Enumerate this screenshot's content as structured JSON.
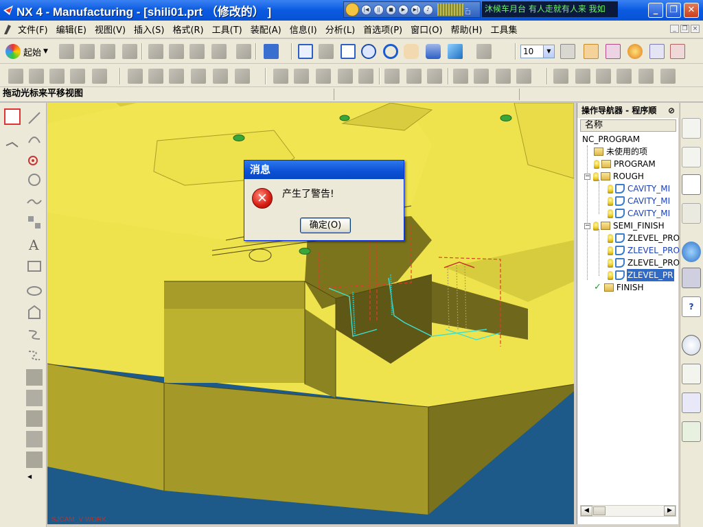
{
  "window": {
    "title": "NX 4 - Manufacturing - [shili01.prt （修改的） ]",
    "ticker": "沐候车月台   有人走就有人来   我如"
  },
  "menu": {
    "items": [
      "文件(F)",
      "编辑(E)",
      "视图(V)",
      "插入(S)",
      "格式(R)",
      "工具(T)",
      "装配(A)",
      "信息(I)",
      "分析(L)",
      "首选项(P)",
      "窗口(O)",
      "帮助(H)",
      "工具集"
    ]
  },
  "toolbar": {
    "start_label": "起始",
    "zoom_value": "10"
  },
  "cue_line": "拖动光标来平移视图",
  "viewport": {
    "wcs_label": "SJCAM_V WORK"
  },
  "navigator": {
    "title": "操作导航器 - 程序顺",
    "column_header": "名称",
    "nodes": [
      {
        "label": "NC_PROGRAM"
      },
      {
        "label": "未使用的项"
      },
      {
        "label": "PROGRAM"
      },
      {
        "label": "ROUGH"
      },
      {
        "label": "CAVITY_MI"
      },
      {
        "label": "CAVITY_MI"
      },
      {
        "label": "CAVITY_MI"
      },
      {
        "label": "SEMI_FINISH"
      },
      {
        "label": "ZLEVEL_PRO"
      },
      {
        "label": "ZLEVEL_PRO"
      },
      {
        "label": "ZLEVEL_PRO"
      },
      {
        "label": "ZLEVEL_PR"
      },
      {
        "label": "FINISH"
      }
    ]
  },
  "dialog": {
    "title": "消息",
    "message": "产生了警告!",
    "ok_label": "确定(O)"
  },
  "colors": {
    "part_face": "#efe34d",
    "part_wall": "#8f8720",
    "background": "#1d5a8a",
    "toolpath_cyan": "#40e0d0",
    "toolpath_red": "#e23a2a"
  }
}
